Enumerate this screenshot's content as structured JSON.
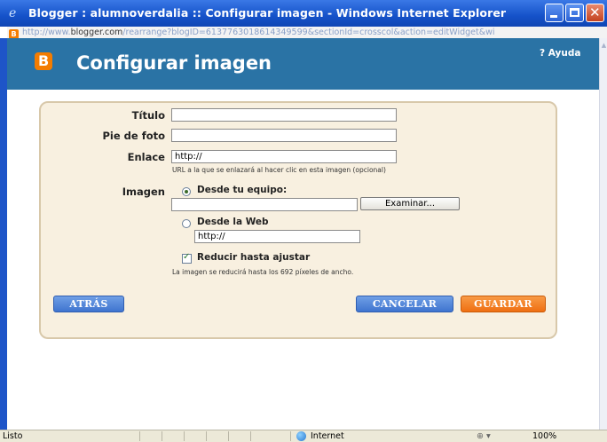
{
  "window": {
    "title": "Blogger : alumnoverdalia :: Configurar imagen - Windows Internet Explorer"
  },
  "address": {
    "prefix": "http://www.",
    "domain": "blogger.com",
    "path": "/rearrange?blogID=6137763018614349599&sectionId=crosscol&action=editWidget&wi"
  },
  "dialog": {
    "logo_letter": "B",
    "title": "Configurar imagen",
    "help": "? Ayuda"
  },
  "form": {
    "titulo_label": "Título",
    "titulo_value": "",
    "pie_label": "Pie de foto",
    "pie_value": "",
    "enlace_label": "Enlace",
    "enlace_value": "http://",
    "enlace_hint": "URL a la que se enlazará al hacer clic en esta imagen (opcional)",
    "imagen_label": "Imagen",
    "option_equipo": "Desde tu equipo:",
    "file_value": "",
    "browse_label": "Examinar...",
    "option_web": "Desde la Web",
    "web_value": "http://",
    "resize_label": "Reducir hasta ajustar",
    "resize_checked": true,
    "resize_hint": "La imagen se reducirá hasta los 692 píxeles de ancho."
  },
  "buttons": {
    "back": "ATRÁS",
    "cancel": "CANCELAR",
    "save": "GUARDAR"
  },
  "statusbar": {
    "text": "Listo",
    "zone": "Internet",
    "zoom": "100%"
  },
  "colors": {
    "header": "#2a73a5",
    "panel": "#f8f0e0",
    "accent_orange": "#f47c00",
    "button_blue": "#4a80d6"
  }
}
